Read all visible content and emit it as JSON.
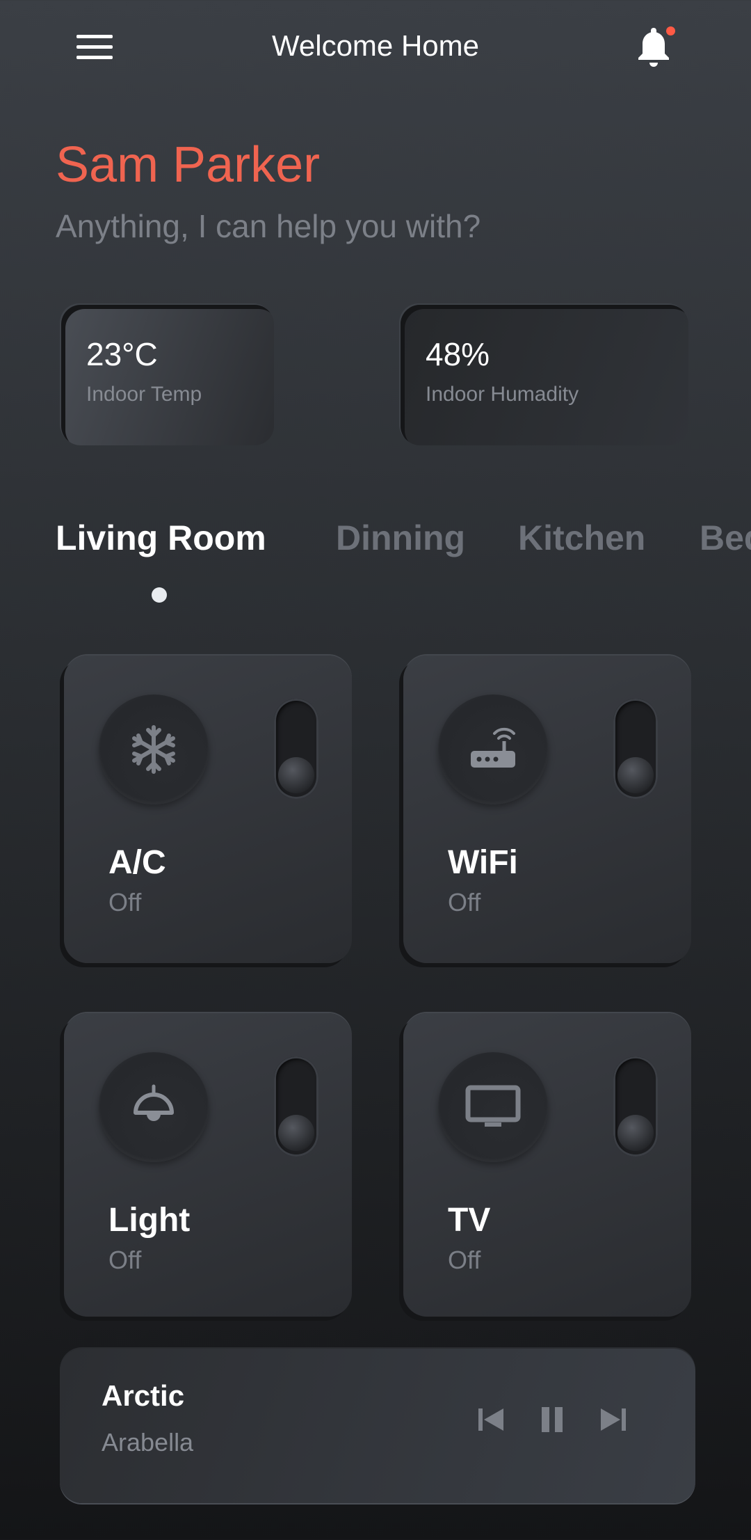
{
  "header": {
    "title": "Welcome Home",
    "menu_icon": "hamburger-menu-icon",
    "notification_icon": "bell-icon",
    "notification_dot_color": "#ff5a45"
  },
  "greeting": {
    "name": "Sam Parker",
    "subtitle": "Anything, I can help you with?",
    "name_color": "#f06450"
  },
  "stats": [
    {
      "value": "23°C",
      "label": "Indoor Temp"
    },
    {
      "value": "48%",
      "label": "Indoor Humadity"
    }
  ],
  "rooms": {
    "tabs": [
      {
        "label": "Living Room",
        "active": true
      },
      {
        "label": "Dinning",
        "active": false
      },
      {
        "label": "Kitchen",
        "active": false
      },
      {
        "label": "Bed",
        "active": false
      }
    ]
  },
  "devices": [
    {
      "title": "A/C",
      "status": "Off",
      "icon": "snowflake-icon",
      "on": false
    },
    {
      "title": "WiFi",
      "status": "Off",
      "icon": "router-icon",
      "on": false
    },
    {
      "title": "Light",
      "status": "Off",
      "icon": "ceiling-lamp-icon",
      "on": false
    },
    {
      "title": "TV",
      "status": "Off",
      "icon": "monitor-icon",
      "on": false
    }
  ],
  "player": {
    "song": "Arctic",
    "artist": "Arabella",
    "controls": [
      "skip-previous-icon",
      "pause-icon",
      "skip-next-icon"
    ]
  }
}
